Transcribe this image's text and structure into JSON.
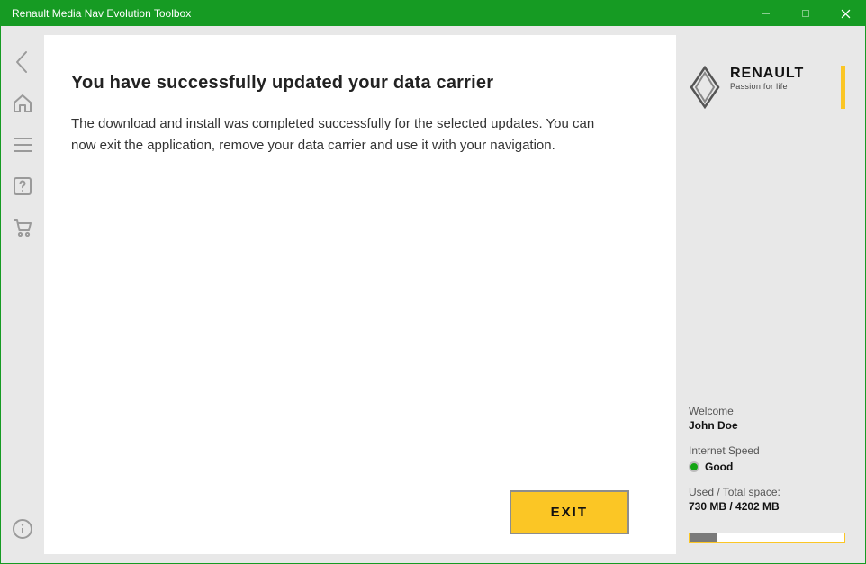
{
  "window": {
    "title": "Renault Media Nav Evolution Toolbox"
  },
  "main": {
    "heading": "You have successfully updated your data carrier",
    "body": "The download and install was completed successfully for the selected updates. You can now exit the application, remove your data carrier and use it with your navigation.",
    "exit_label": "EXIT"
  },
  "brand": {
    "name": "RENAULT",
    "tagline": "Passion for life"
  },
  "status": {
    "welcome_label": "Welcome",
    "username": "John Doe",
    "speed_label": "Internet Speed",
    "speed_value": "Good",
    "speed_color": "#14a514",
    "space_label": "Used / Total space:",
    "space_value": "730 MB / 4202 MB",
    "used_mb": 730,
    "total_mb": 4202
  },
  "colors": {
    "titlebar": "#169b23",
    "accent": "#fbc625"
  }
}
